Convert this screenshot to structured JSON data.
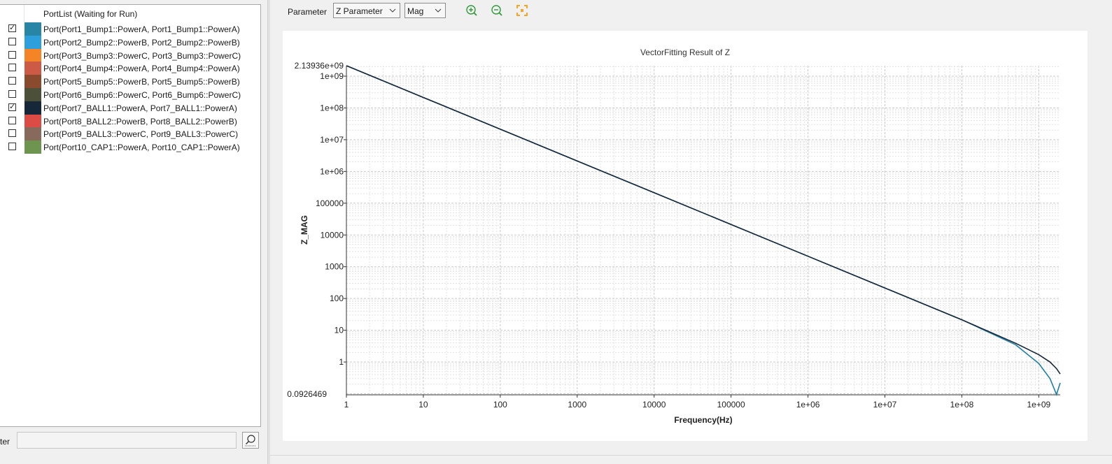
{
  "port_list": {
    "header": "PortList (Waiting for Run)",
    "ports": [
      {
        "label": "Port(Port1_Bump1::PowerA, Port1_Bump1::PowerA)",
        "checked": true,
        "color": "#2885a6"
      },
      {
        "label": "Port(Port2_Bump2::PowerB, Port2_Bump2::PowerB)",
        "checked": false,
        "color": "#2e9fdd"
      },
      {
        "label": "Port(Port3_Bump3::PowerC, Port3_Bump3::PowerC)",
        "checked": false,
        "color": "#f58426"
      },
      {
        "label": "Port(Port4_Bump4::PowerA, Port4_Bump4::PowerA)",
        "checked": false,
        "color": "#cc5a45"
      },
      {
        "label": "Port(Port5_Bump5::PowerB, Port5_Bump5::PowerB)",
        "checked": false,
        "color": "#8a4a2e"
      },
      {
        "label": "Port(Port6_Bump6::PowerC, Port6_Bump6::PowerC)",
        "checked": false,
        "color": "#4c5039"
      },
      {
        "label": "Port(Port7_BALL1::PowerA, Port7_BALL1::PowerA)",
        "checked": true,
        "color": "#17273a"
      },
      {
        "label": "Port(Port8_BALL2::PowerB, Port8_BALL2::PowerB)",
        "checked": false,
        "color": "#dc4c45"
      },
      {
        "label": "Port(Port9_BALL3::PowerC, Port9_BALL3::PowerC)",
        "checked": false,
        "color": "#886a5c"
      },
      {
        "label": "Port(Port10_CAP1::PowerA, Port10_CAP1::PowerA)",
        "checked": false,
        "color": "#6d9550"
      }
    ]
  },
  "filter": {
    "label": "ter",
    "value": ""
  },
  "toolbar": {
    "parameter_label": "Parameter",
    "parameter_value": "Z Parameter",
    "format_value": "Mag",
    "icons": [
      "zoom-in-icon",
      "zoom-out-icon",
      "fit-view-icon"
    ],
    "icon_colors": {
      "zoom": "#2e9a3a",
      "fit": "#f5a623"
    }
  },
  "chart_data": {
    "type": "line",
    "title": "VectorFitting Result of Z",
    "xlabel": "Frequency(Hz)",
    "ylabel": "Z_MAG",
    "x_scale": "log",
    "y_scale": "log",
    "xlim": [
      1,
      1900000000
    ],
    "ylim": [
      0.0926469,
      2139360000
    ],
    "x_ticks": [
      "1",
      "10",
      "100",
      "1000",
      "10000",
      "100000",
      "1e+06",
      "1e+07",
      "1e+08",
      "1e+09"
    ],
    "y_ticks": [
      "1e+09",
      "1e+08",
      "1e+07",
      "1e+06",
      "100000",
      "10000",
      "1000",
      "100",
      "10",
      "1"
    ],
    "y_max_label": "2.13936e+09",
    "y_min_label": "0.0926469",
    "grid": true,
    "series": [
      {
        "color": "#1f7fa5",
        "x": [
          1,
          10,
          100,
          1000,
          10000,
          100000,
          1000000,
          10000000,
          100000000,
          500000000,
          1000000000,
          1400000000,
          1700000000,
          1900000000
        ],
        "y": [
          2139360000,
          213936000,
          21393600,
          2139360,
          213936,
          21393.6,
          2139.36,
          213.9,
          21.4,
          3.5,
          0.9,
          0.3,
          0.095,
          0.22
        ]
      },
      {
        "color": "#17273a",
        "x": [
          1,
          10,
          100,
          1000,
          10000,
          100000,
          1000000,
          10000000,
          100000000,
          500000000,
          1000000000,
          1400000000,
          1700000000,
          1900000000
        ],
        "y": [
          2139360000,
          213936000,
          21393600,
          2139360,
          213936,
          21393.6,
          2139.36,
          213.9,
          21.4,
          3.9,
          1.7,
          1.0,
          0.62,
          0.42
        ]
      }
    ]
  }
}
